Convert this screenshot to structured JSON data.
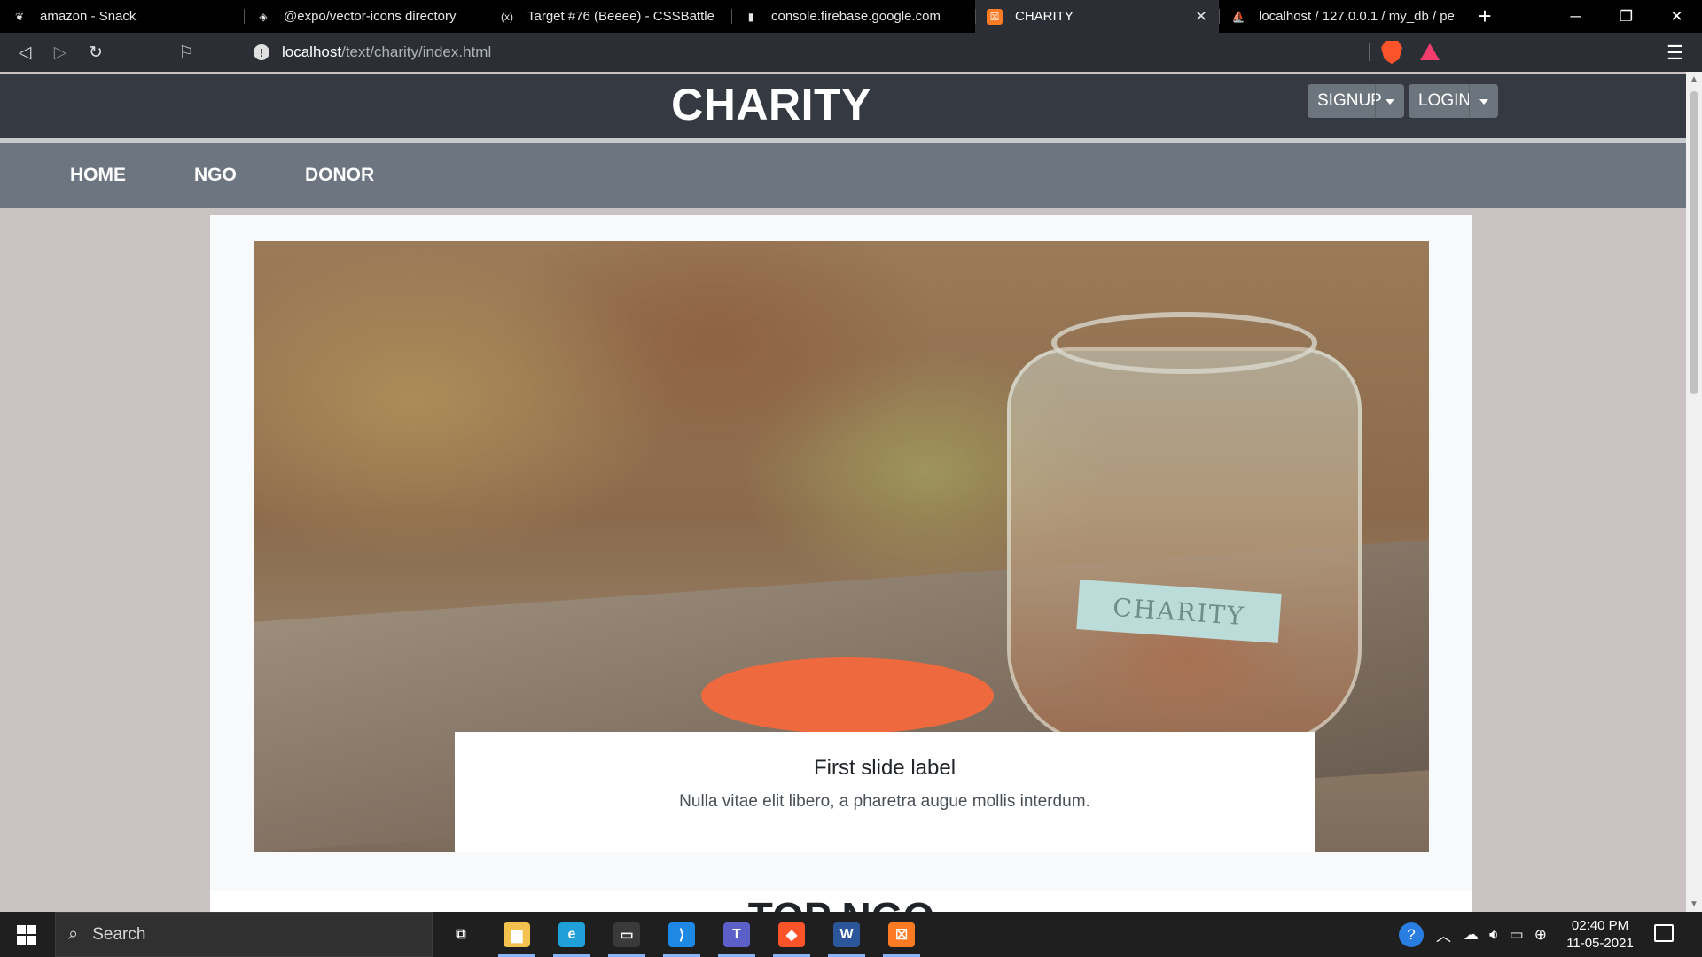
{
  "browser": {
    "tabs": [
      {
        "title": "amazon - Snack",
        "icon": "expo-snack-icon",
        "icon_char": "❦",
        "icon_bg": "#000000",
        "active": false
      },
      {
        "title": "@expo/vector-icons directory",
        "icon": "expo-icons-icon",
        "icon_char": "◈",
        "icon_bg": "#000000",
        "active": false
      },
      {
        "title": "Target #76 (Beeee) - CSSBattle",
        "icon": "cssbattle-icon",
        "icon_char": "(x)",
        "icon_bg": "#000000",
        "active": false
      },
      {
        "title": "console.firebase.google.com",
        "icon": "page-icon",
        "icon_char": "▮",
        "icon_bg": "#000000",
        "active": false
      },
      {
        "title": "CHARITY",
        "icon": "xampp-icon",
        "icon_char": "☒",
        "icon_bg": "#fb7a24",
        "active": true
      },
      {
        "title": "localhost / 127.0.0.1 / my_db / per",
        "icon": "phpmyadmin-icon",
        "icon_char": "⛵",
        "icon_bg": "#000000",
        "active": false
      }
    ],
    "new_tab_glyph": "+",
    "close_glyph": "✕",
    "url_host": "localhost",
    "url_path": "/text/charity/index.html"
  },
  "site": {
    "title": "CHARITY",
    "signup_label": "SIGNUP",
    "login_label": "LOGIN",
    "nav": [
      "HOME",
      "NGO",
      "DONOR"
    ],
    "carousel": {
      "image_label": "CHARITY",
      "caption_title": "First slide label",
      "caption_text": "Nulla vitae elit libero, a pharetra augue mollis interdum."
    },
    "section_title": "TOP NGO"
  },
  "taskbar": {
    "search_placeholder": "Search",
    "apps": [
      {
        "name": "task-view-icon",
        "char": "⧉",
        "bg": "transparent"
      },
      {
        "name": "file-explorer-icon",
        "char": "▆",
        "bg": "#f2c14e"
      },
      {
        "name": "edge-icon",
        "char": "e",
        "bg": "#1fa0d8"
      },
      {
        "name": "terminal-icon",
        "char": "▭",
        "bg": "#3a3a3a"
      },
      {
        "name": "vscode-icon",
        "char": "⟩",
        "bg": "#1e88e5"
      },
      {
        "name": "teams-icon",
        "char": "T",
        "bg": "#5b5fc7"
      },
      {
        "name": "brave-icon",
        "char": "◆",
        "bg": "#fb542b"
      },
      {
        "name": "word-icon",
        "char": "W",
        "bg": "#2b579a"
      },
      {
        "name": "xampp-icon",
        "char": "☒",
        "bg": "#fb7a24"
      }
    ],
    "time": "02:40 PM",
    "date": "11-05-2021"
  },
  "colors": {
    "site_header": "#353a42",
    "navbar": "#6d7581",
    "page_bg": "#cbc3c3",
    "button": "#6c757d"
  }
}
